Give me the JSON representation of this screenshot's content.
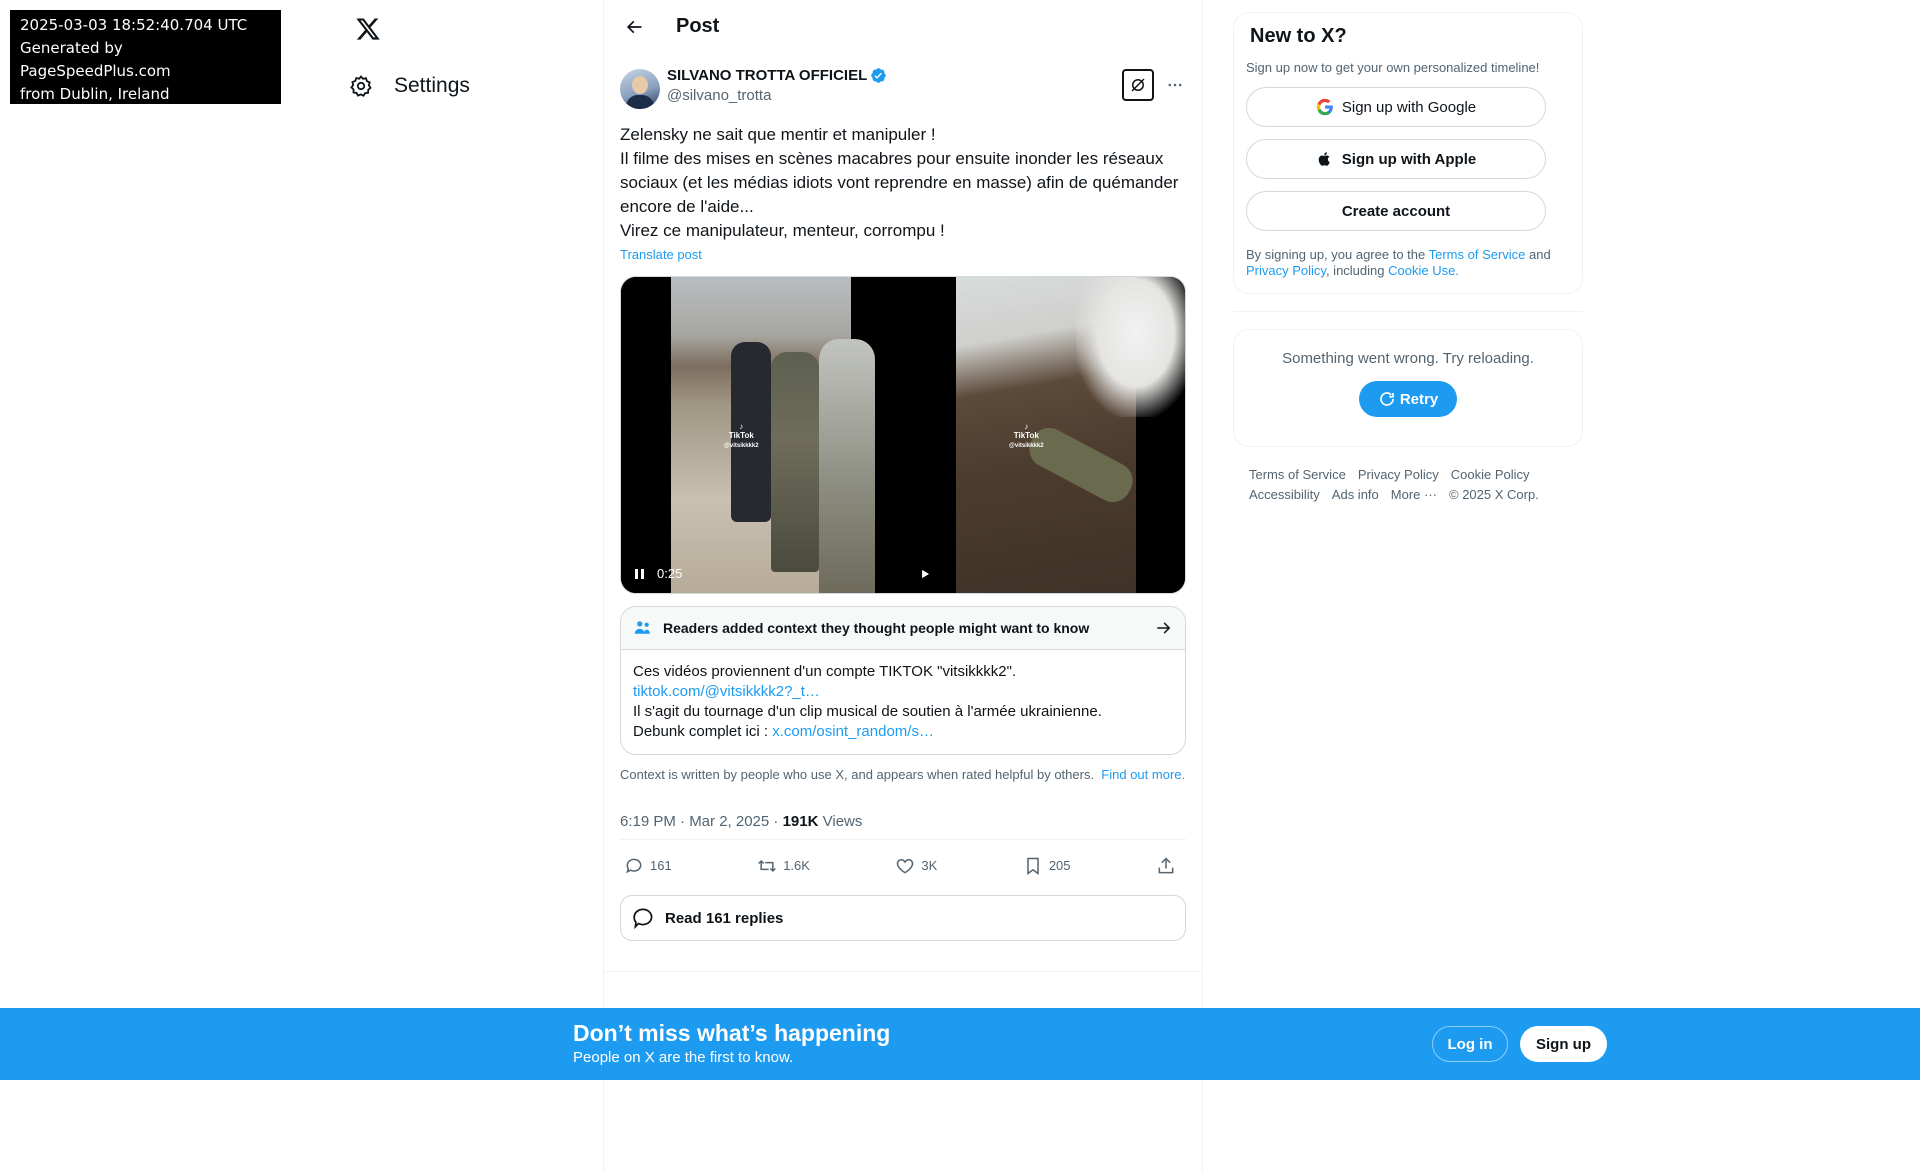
{
  "stamp": {
    "line1": "2025-03-03 18:52:40.704 UTC",
    "line2": "Generated by PageSpeedPlus.com",
    "line3": "from Dublin, Ireland"
  },
  "nav": {
    "settings_label": "Settings"
  },
  "header": {
    "title": "Post"
  },
  "post": {
    "author_name": "SILVANO TROTTA OFFICIEL",
    "author_handle": "@silvano_trotta",
    "text": "Zelensky ne sait que mentir et manipuler !\nIl filme des mises en scènes macabres pour ensuite inonder les réseaux sociaux (et les médias idiots vont reprendre en masse) afin de quémander encore de l'aide...\nVirez ce manipulateur, menteur, corrompu !",
    "translate_label": "Translate post",
    "video1_time": "0:25",
    "tiktok_brand": "TikTok",
    "tiktok_handle": "@vitsikkkk2",
    "timestamp": "6:19 PM · Mar 2, 2025",
    "separator": "·",
    "views_count": "191K",
    "views_label": "Views"
  },
  "community_note": {
    "header": "Readers added context they thought people might want to know",
    "line1": "Ces vidéos proviennent d'un compte TIKTOK \"vitsikkkk2\".",
    "link1": "tiktok.com/@vitsikkkk2?_t…",
    "line2": "Il s'agit du tournage d'un clip musical de soutien à l'armée ukrainienne.",
    "line3_prefix": "Debunk complet ici : ",
    "link2": "x.com/osint_random/s…",
    "footer_text": "Context is written by people who use X, and appears when rated helpful by others.",
    "footer_link": "Find out more."
  },
  "stats": {
    "replies": "161",
    "reposts": "1.6K",
    "likes": "3K",
    "bookmarks": "205"
  },
  "read_replies_label": "Read 161 replies",
  "sidebar": {
    "title": "New to X?",
    "subtitle": "Sign up now to get your own personalized timeline!",
    "google_label": "Sign up with Google",
    "apple_label": "Sign up with Apple",
    "create_label": "Create account",
    "legal_prefix": "By signing up, you agree to the ",
    "terms_link": "Terms of Service",
    "legal_and": " and ",
    "privacy_link": "Privacy Policy",
    "legal_including": ", including ",
    "cookie_link": "Cookie Use.",
    "error_msg": "Something went wrong. Try reloading.",
    "retry_label": "Retry",
    "footer_links": [
      "Terms of Service",
      "Privacy Policy",
      "Cookie Policy",
      "Accessibility",
      "Ads info",
      "More ···",
      "© 2025 X Corp."
    ]
  },
  "banner": {
    "headline": "Don’t miss what’s happening",
    "subline": "People on X are the first to know.",
    "login_label": "Log in",
    "signup_label": "Sign up"
  },
  "colors": {
    "accent": "#1d9bf0",
    "text_primary": "#0f1419",
    "text_secondary": "#536471",
    "border": "#cfd9de"
  }
}
